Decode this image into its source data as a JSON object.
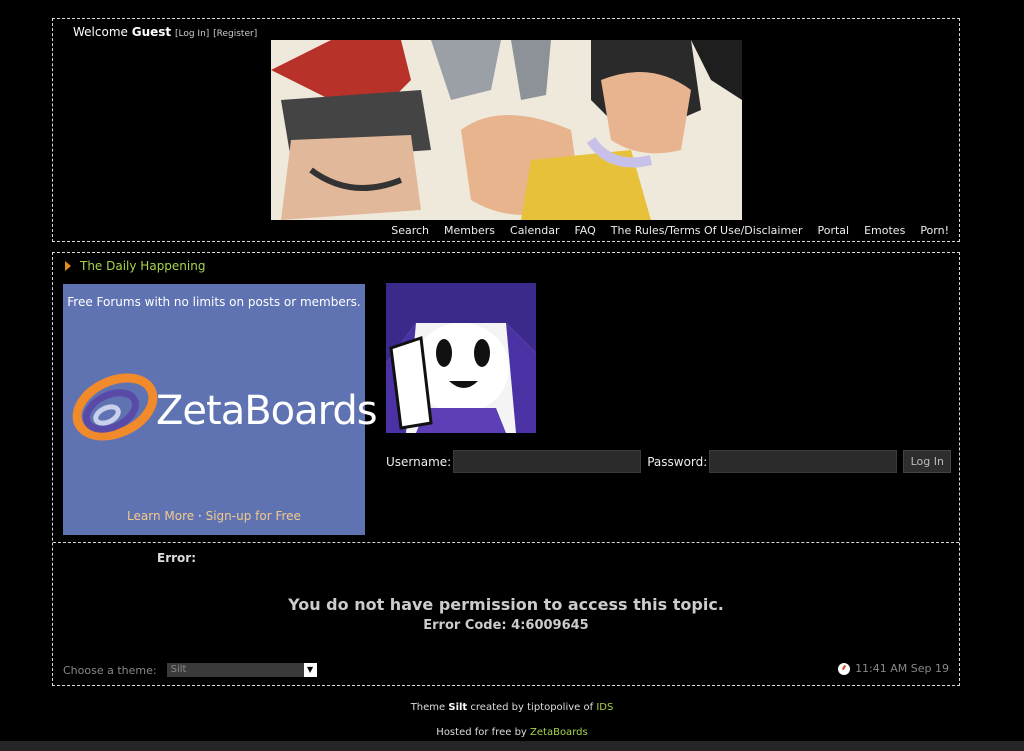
{
  "header": {
    "welcome_prefix": "Welcome",
    "user": "Guest",
    "login_link": "[Log In]",
    "register_link": "[Register]",
    "nav": [
      "Search",
      "Members",
      "Calendar",
      "FAQ",
      "The Rules/Terms Of Use/Disclaimer",
      "Portal",
      "Emotes",
      "Porn!"
    ]
  },
  "section": {
    "title": "The Daily Happening"
  },
  "ad": {
    "top_text": "Free Forums with no limits on posts or members.",
    "logo_text": "ZetaBoards",
    "learn_more": "Learn More",
    "separator": " · ",
    "signup": "Sign-up for Free"
  },
  "login": {
    "username_label": "Username:",
    "password_label": "Password:",
    "button_label": "Log In"
  },
  "error": {
    "label": "Error:",
    "message": "You do not have permission to access this topic.",
    "code": "Error Code: 4:6009645"
  },
  "footer": {
    "theme_label": "Choose a theme:",
    "theme_value": "Silt",
    "time": "11:41 AM Sep 19"
  },
  "credits": {
    "theme_prefix": "Theme",
    "theme_name": "Silt",
    "created_by": "created by tiptopolive of",
    "ids": "IDS",
    "hosted_prefix": "Hosted for free by",
    "host": "ZetaBoards"
  },
  "colors": {
    "accent_green": "#a7d44c",
    "accent_orange": "#e38b1b",
    "ad_blue": "#5f73b3"
  }
}
